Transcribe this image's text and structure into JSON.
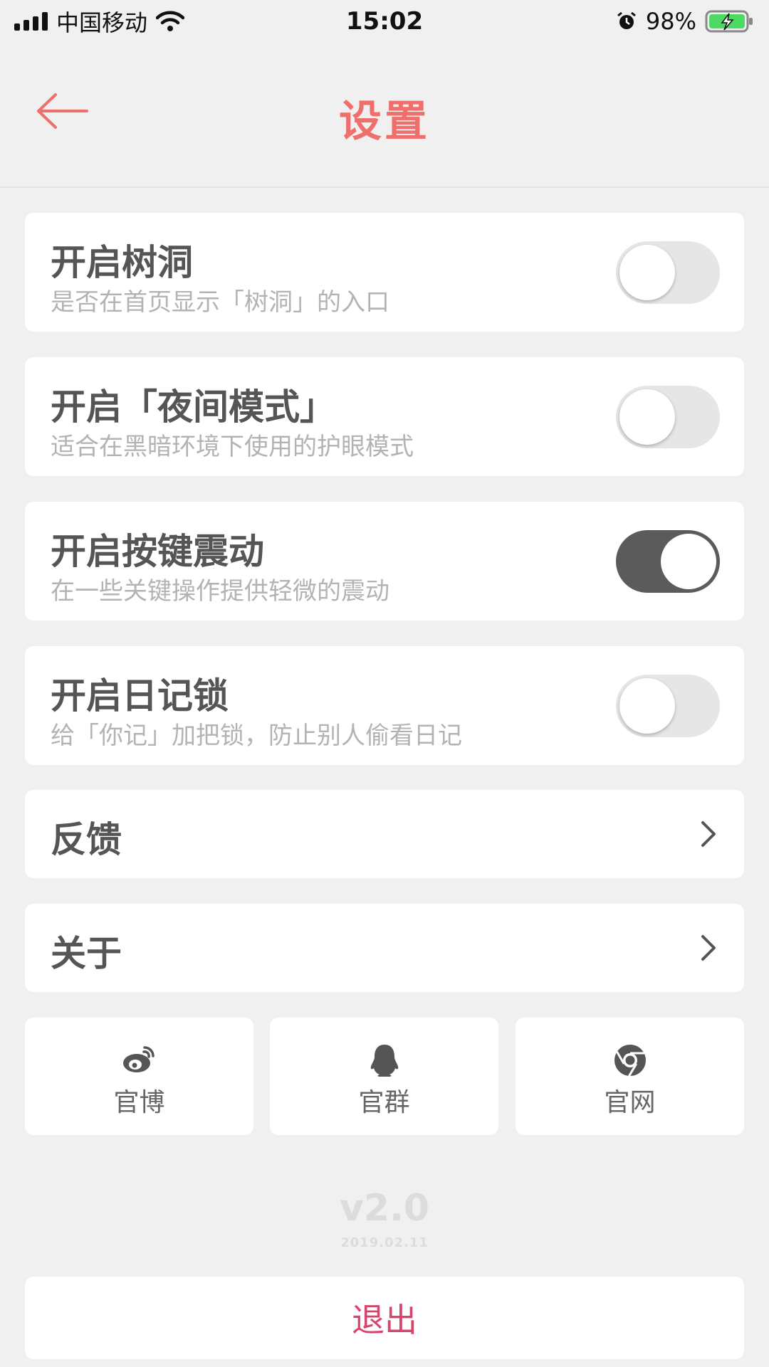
{
  "status_bar": {
    "carrier": "中国移动",
    "time": "15:02",
    "battery": "98%",
    "icons": [
      "signal-icon",
      "wifi-icon",
      "alarm-icon",
      "battery-charging-icon"
    ]
  },
  "nav": {
    "title": "设置",
    "back_icon": "arrow-left-icon"
  },
  "settings": [
    {
      "title": "开启树洞",
      "subtitle": "是否在首页显示「树洞」的入口",
      "on": false
    },
    {
      "title": "开启「夜间模式」",
      "subtitle": "适合在黑暗环境下使用的护眼模式",
      "on": false
    },
    {
      "title": "开启按键震动",
      "subtitle": "在一些关键操作提供轻微的震动",
      "on": true
    },
    {
      "title": "开启日记锁",
      "subtitle": "给「你记」加把锁，防止别人偷看日记",
      "on": false
    }
  ],
  "links": [
    {
      "label": "反馈",
      "icon": "chevron-right-icon"
    },
    {
      "label": "关于",
      "icon": "chevron-right-icon"
    }
  ],
  "social": [
    {
      "label": "官博",
      "icon": "weibo-icon"
    },
    {
      "label": "官群",
      "icon": "qq-icon"
    },
    {
      "label": "官网",
      "icon": "chrome-icon"
    }
  ],
  "version": {
    "number": "v2.0",
    "date": "2019.02.11"
  },
  "logout_label": "退出",
  "colors": {
    "accent": "#ef6f6c",
    "logout": "#d6456e",
    "toggle_on": "#5b5b5b",
    "toggle_off": "#e6e6e6",
    "background": "#f0f0f0"
  }
}
